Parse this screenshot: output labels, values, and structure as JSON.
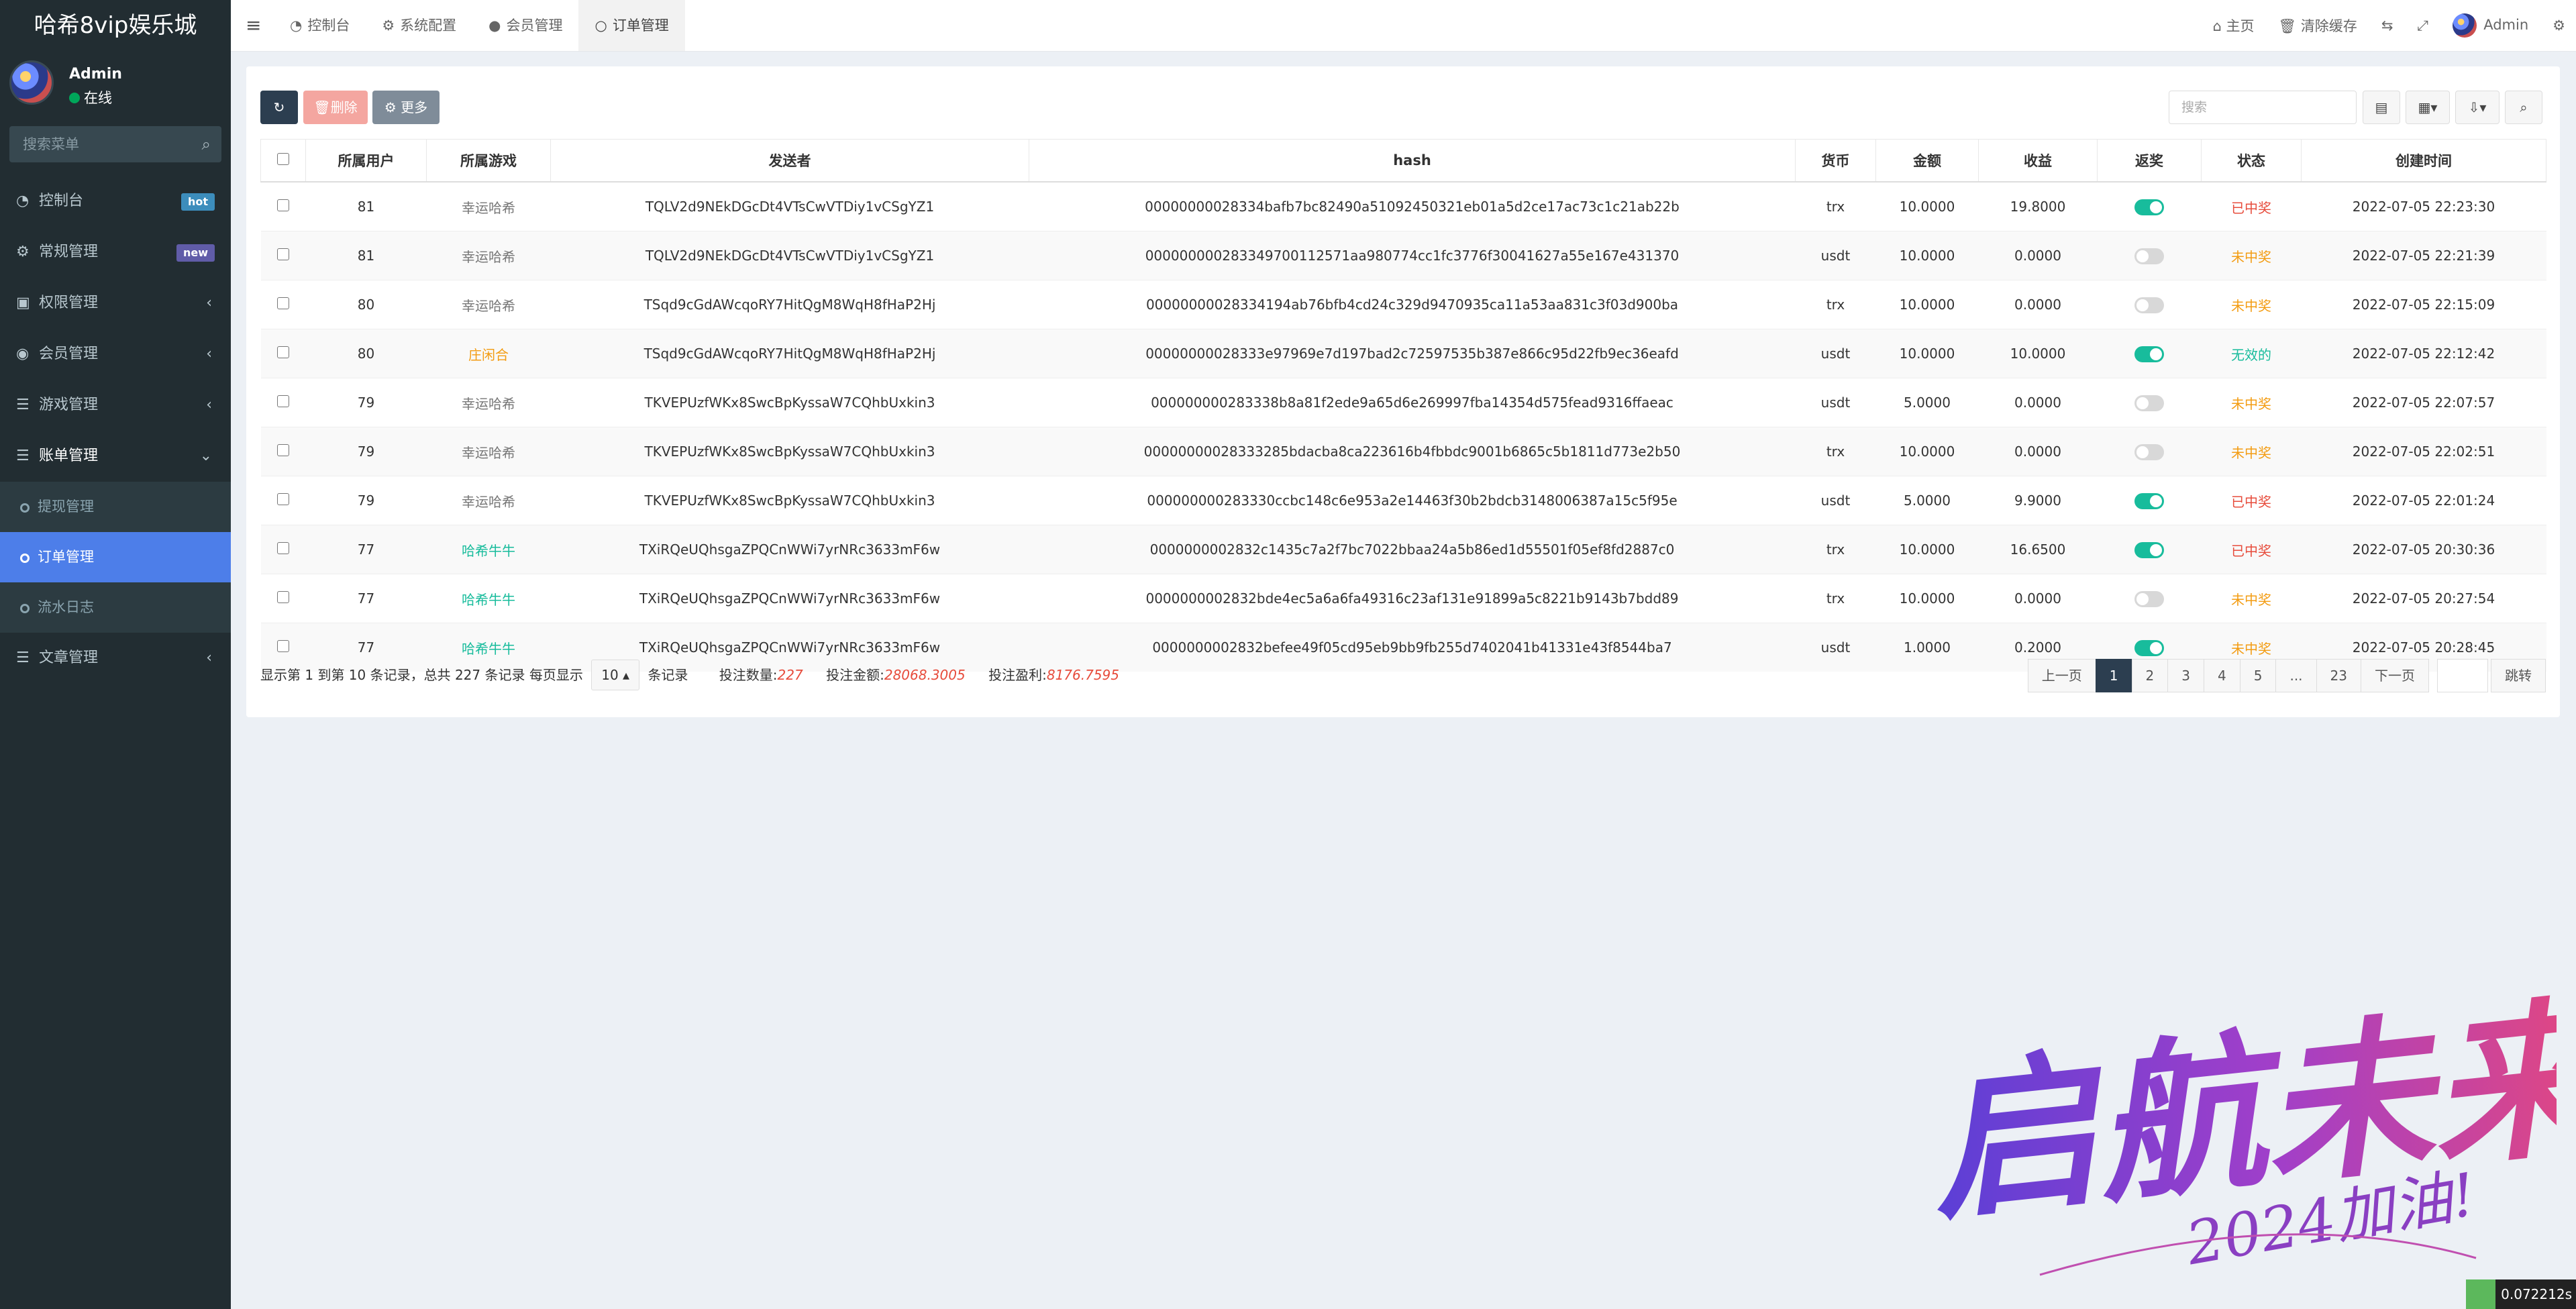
{
  "app": {
    "title": "哈希8vip娱乐城"
  },
  "user": {
    "name": "Admin",
    "status": "在线"
  },
  "sidebar": {
    "search_placeholder": "搜索菜单",
    "items": [
      {
        "label": "控制台",
        "icon": "dashboard-icon",
        "badge": "hot"
      },
      {
        "label": "常规管理",
        "icon": "cogs-icon",
        "badge": "new"
      },
      {
        "label": "权限管理",
        "icon": "group-icon"
      },
      {
        "label": "会员管理",
        "icon": "user-circle-icon"
      },
      {
        "label": "游戏管理",
        "icon": "list-icon"
      },
      {
        "label": "账单管理",
        "icon": "list-icon"
      }
    ],
    "subitems": [
      {
        "label": "提现管理"
      },
      {
        "label": "订单管理"
      },
      {
        "label": "流水日志"
      }
    ],
    "article": {
      "label": "文章管理"
    }
  },
  "header": {
    "tabs": [
      {
        "label": "控制台"
      },
      {
        "label": "系统配置"
      },
      {
        "label": "会员管理"
      },
      {
        "label": "订单管理"
      }
    ],
    "home": "主页",
    "clear_cache": "清除缓存",
    "admin": "Admin"
  },
  "toolbar": {
    "delete": "删除",
    "more": "更多",
    "search_placeholder": "搜索"
  },
  "table": {
    "columns": [
      "所属用户",
      "所属游戏",
      "发送者",
      "hash",
      "货币",
      "金额",
      "收益",
      "返奖",
      "状态",
      "创建时间"
    ],
    "rows": [
      {
        "user": "81",
        "game": "幸运哈希",
        "sender": "TQLV2d9NEkDGcDt4VTsCwVTDiy1vCSgYZ1",
        "hash": "00000000028334bafb7bc82490a51092450321eb01a5d2ce17ac73c1c21ab22b",
        "currency": "trx",
        "amount": "10.0000",
        "profit": "19.8000",
        "rebate": true,
        "status": "已中奖",
        "created": "2022-07-05 22:23:30"
      },
      {
        "user": "81",
        "game": "幸运哈希",
        "sender": "TQLV2d9NEkDGcDt4VTsCwVTDiy1vCSgYZ1",
        "hash": "000000000283349700112571aa980774cc1fc3776f30041627a55e167e431370",
        "currency": "usdt",
        "amount": "10.0000",
        "profit": "0.0000",
        "rebate": false,
        "status": "未中奖",
        "created": "2022-07-05 22:21:39"
      },
      {
        "user": "80",
        "game": "幸运哈希",
        "sender": "TSqd9cGdAWcqoRY7HitQgM8WqH8fHaP2Hj",
        "hash": "00000000028334194ab76bfb4cd24c329d9470935ca11a53aa831c3f03d900ba",
        "currency": "trx",
        "amount": "10.0000",
        "profit": "0.0000",
        "rebate": false,
        "status": "未中奖",
        "created": "2022-07-05 22:15:09"
      },
      {
        "user": "80",
        "game": "庄闲合",
        "sender": "TSqd9cGdAWcqoRY7HitQgM8WqH8fHaP2Hj",
        "hash": "00000000028333e97969e7d197bad2c72597535b387e866c95d22fb9ec36eafd",
        "currency": "usdt",
        "amount": "10.0000",
        "profit": "10.0000",
        "rebate": true,
        "status": "无效的",
        "created": "2022-07-05 22:12:42"
      },
      {
        "user": "79",
        "game": "幸运哈希",
        "sender": "TKVEPUzfWKx8SwcBpKyssaW7CQhbUxkin3",
        "hash": "000000000283338b8a81f2ede9a65d6e269997fba14354d575fead9316ffaeac",
        "currency": "usdt",
        "amount": "5.0000",
        "profit": "0.0000",
        "rebate": false,
        "status": "未中奖",
        "created": "2022-07-05 22:07:57"
      },
      {
        "user": "79",
        "game": "幸运哈希",
        "sender": "TKVEPUzfWKx8SwcBpKyssaW7CQhbUxkin3",
        "hash": "00000000028333285bdacba8ca223616b4fbbdc9001b6865c5b1811d773e2b50",
        "currency": "trx",
        "amount": "10.0000",
        "profit": "0.0000",
        "rebate": false,
        "status": "未中奖",
        "created": "2022-07-05 22:02:51"
      },
      {
        "user": "79",
        "game": "幸运哈希",
        "sender": "TKVEPUzfWKx8SwcBpKyssaW7CQhbUxkin3",
        "hash": "000000000283330ccbc148c6e953a2e14463f30b2bdcb3148006387a15c5f95e",
        "currency": "usdt",
        "amount": "5.0000",
        "profit": "9.9000",
        "rebate": true,
        "status": "已中奖",
        "created": "2022-07-05 22:01:24"
      },
      {
        "user": "77",
        "game": "哈希牛牛",
        "sender": "TXiRQeUQhsgaZPQCnWWi7yrNRc3633mF6w",
        "hash": "0000000002832c1435c7a2f7bc7022bbaa24a5b86ed1d55501f05ef8fd2887c0",
        "currency": "trx",
        "amount": "10.0000",
        "profit": "16.6500",
        "rebate": true,
        "status": "已中奖",
        "created": "2022-07-05 20:30:36"
      },
      {
        "user": "77",
        "game": "哈希牛牛",
        "sender": "TXiRQeUQhsgaZPQCnWWi7yrNRc3633mF6w",
        "hash": "0000000002832bde4ec5a6a6fa49316c23af131e91899a5c8221b9143b7bdd89",
        "currency": "trx",
        "amount": "10.0000",
        "profit": "0.0000",
        "rebate": false,
        "status": "未中奖",
        "created": "2022-07-05 20:27:54"
      },
      {
        "user": "77",
        "game": "哈希牛牛",
        "sender": "TXiRQeUQhsgaZPQCnWWi7yrNRc3633mF6w",
        "hash": "0000000002832befee49f05cd95eb9bb9fb255d7402041b41331e43f8544ba7",
        "currency": "usdt",
        "amount": "1.0000",
        "profit": "0.2000",
        "rebate": true,
        "status": "未中奖",
        "created": "2022-07-05 20:28:45"
      }
    ]
  },
  "footer": {
    "summary": "显示第 1 到第 10 条记录，总共 227 条记录 每页显示",
    "page_size": "10",
    "records_suffix": "条记录",
    "bet_count_label": "投注数量:",
    "bet_count": "227",
    "bet_amount_label": "投注金额:",
    "bet_amount": "28068.3005",
    "bet_profit_label": "投注盈利:",
    "bet_profit": "8176.7595"
  },
  "pagination": {
    "prev": "上一页",
    "pages": [
      "1",
      "2",
      "3",
      "4",
      "5",
      "...",
      "23"
    ],
    "next": "下一页",
    "jump": "跳转"
  },
  "watermark": {
    "text": "启航未来",
    "subtext": "2024加油!"
  },
  "perf": {
    "time": "0.072212s"
  },
  "colors": {
    "sidebar": "#222d32",
    "accent": "#4d7ee9",
    "win": "#e74c3c",
    "lose": "#f39c12",
    "void": "#18bc9c",
    "toggle_on": "#18bc9c"
  }
}
